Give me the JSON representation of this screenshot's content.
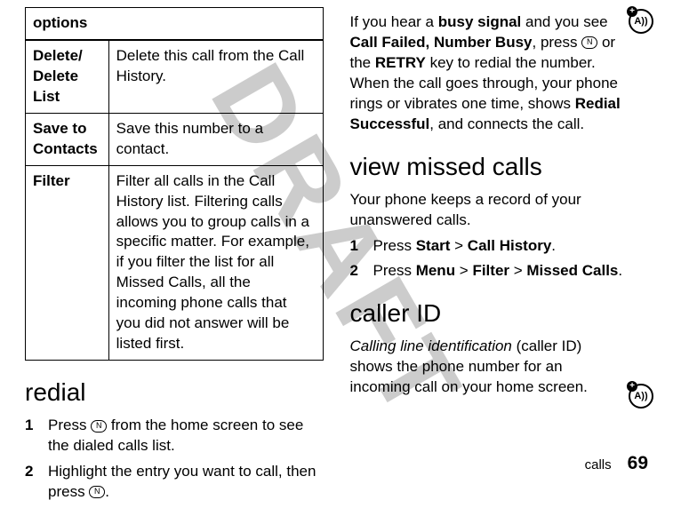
{
  "watermark": "DRAFT",
  "table": {
    "header": "options",
    "rows": [
      {
        "label": "Delete/ Delete List",
        "desc": "Delete this call from the Call History."
      },
      {
        "label": "Save to Contacts",
        "desc": "Save this number to a contact."
      },
      {
        "label": "Filter",
        "desc": "Filter all calls in the Call History list. Filtering calls allows you to group calls in a specific matter. For example, if you filter the list for all Missed Calls, all the incoming phone calls that you did not answer will be listed first."
      }
    ]
  },
  "secRedial": {
    "heading": "redial",
    "step1_pre": "Press ",
    "step1_post": " from the home screen to see the dialed calls list.",
    "step2_pre": "Highlight the entry you want to call, then press ",
    "step2_post": ".",
    "num1": "1",
    "num2": "2",
    "btn": "N"
  },
  "secBusy": {
    "p1a": "If you hear a ",
    "p1b": "busy signal",
    "p1c": " and you see ",
    "p1d": "Call Failed, Number Busy",
    "p1e": ", press ",
    "p1f": " or the ",
    "p1g": "RETRY",
    "p1h": " key to redial the number. When the call goes through, your phone rings or vibrates one time, shows ",
    "p1i": "Redial Successful",
    "p1j": ", and connects the call.",
    "btn": "N"
  },
  "secMissed": {
    "heading": "view missed calls",
    "intro": "Your phone keeps a record of your unanswered calls.",
    "num1": "1",
    "num2": "2",
    "s1a": "Press ",
    "s1b": "Start",
    "s1c": " > ",
    "s1d": "Call History",
    "s1e": ".",
    "s2a": "Press ",
    "s2b": "Menu",
    "s2c": " > ",
    "s2d": "Filter",
    "s2e": " > ",
    "s2f": "Missed Calls",
    "s2g": "."
  },
  "secCaller": {
    "heading": "caller ID",
    "p1a": "Calling line identification",
    "p1b": " (caller ID) shows the phone number for an incoming call on your home screen."
  },
  "badge": {
    "inner": "A))",
    "plus": "+"
  },
  "footer": {
    "label": "calls",
    "page": "69"
  }
}
